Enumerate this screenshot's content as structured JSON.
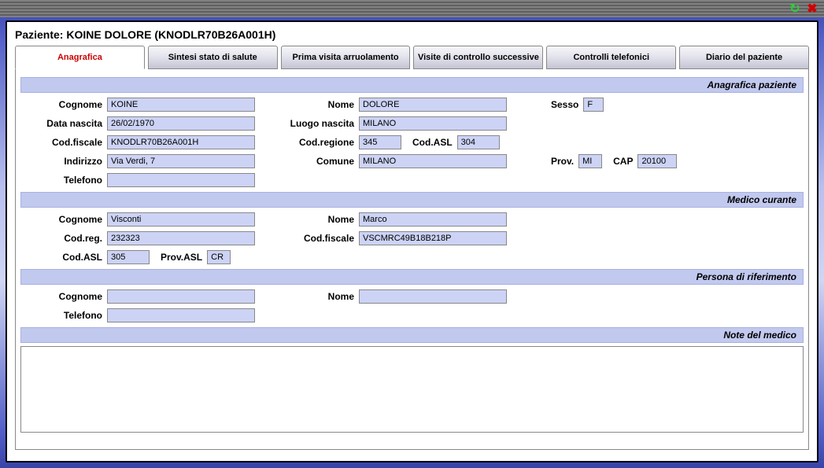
{
  "titlebar": {
    "refresh_icon": "↻",
    "close_icon": "✖"
  },
  "patient_header": "Paziente: KOINE DOLORE (KNODLR70B26A001H)",
  "tabs": [
    {
      "label": "Anagrafica",
      "active": true
    },
    {
      "label": "Sintesi stato di salute",
      "active": false
    },
    {
      "label": "Prima visita arruolamento",
      "active": false
    },
    {
      "label": "Visite di controllo successive",
      "active": false
    },
    {
      "label": "Controlli telefonici",
      "active": false
    },
    {
      "label": "Diario del paziente",
      "active": false
    }
  ],
  "sections": {
    "anagrafica_paziente": "Anagrafica paziente",
    "medico_curante": "Medico curante",
    "persona_riferimento": "Persona di riferimento",
    "note_medico": "Note del medico"
  },
  "labels": {
    "cognome": "Cognome",
    "nome": "Nome",
    "sesso": "Sesso",
    "data_nascita": "Data nascita",
    "luogo_nascita": "Luogo nascita",
    "cod_fiscale": "Cod.fiscale",
    "cod_regione": "Cod.regione",
    "cod_asl": "Cod.ASL",
    "indirizzo": "Indirizzo",
    "comune": "Comune",
    "prov": "Prov.",
    "cap": "CAP",
    "telefono": "Telefono",
    "cod_reg": "Cod.reg.",
    "prov_asl": "Prov.ASL"
  },
  "paziente": {
    "cognome": "KOINE",
    "nome": "DOLORE",
    "sesso": "F",
    "data_nascita": "26/02/1970",
    "luogo_nascita": "MILANO",
    "cod_fiscale": "KNODLR70B26A001H",
    "cod_regione": "345",
    "cod_asl": "304",
    "indirizzo": "Via Verdi, 7",
    "comune": "MILANO",
    "prov": "MI",
    "cap": "20100",
    "telefono": ""
  },
  "medico": {
    "cognome": "Visconti",
    "nome": "Marco",
    "cod_reg": "232323",
    "cod_fiscale": "VSCMRC49B18B218P",
    "cod_asl": "305",
    "prov_asl": "CR"
  },
  "riferimento": {
    "cognome": "",
    "nome": "",
    "telefono": ""
  },
  "note": ""
}
